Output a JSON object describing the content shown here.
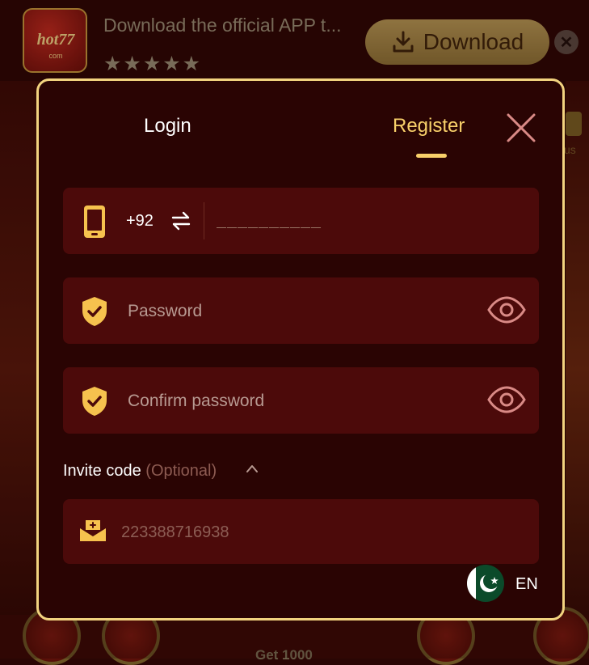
{
  "banner": {
    "logo_text": "hot77",
    "logo_sub": "com",
    "message": "Download the official APP t...",
    "stars": "★★★★★",
    "download_label": "Download",
    "close_symbol": "✕"
  },
  "background": {
    "side_label": "us",
    "bottom_text": "Get 1000"
  },
  "tabs": {
    "login": "Login",
    "register": "Register",
    "active": "Register"
  },
  "phone": {
    "country_code": "+92",
    "placeholder": "__________"
  },
  "password": {
    "placeholder": "Password"
  },
  "confirm_password": {
    "placeholder": "Confirm password"
  },
  "invite": {
    "label": "Invite code",
    "optional": "(Optional)",
    "value": "223388716938"
  },
  "language": {
    "code": "EN",
    "flag": "pakistan-flag-icon"
  },
  "colors": {
    "accent": "#f8d06a",
    "field_bg": "#4c0a0a",
    "modal_bg": "#2a0403",
    "border": "#f2d37f"
  }
}
